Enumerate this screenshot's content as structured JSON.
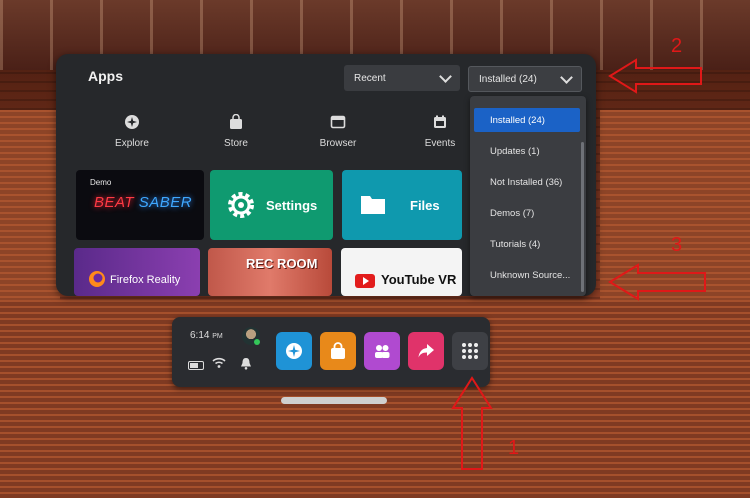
{
  "panel": {
    "title": "Apps",
    "sort_dropdown": {
      "value": "Recent"
    },
    "filter_dropdown": {
      "value": "Installed (24)"
    },
    "nav": [
      {
        "label": "Explore",
        "icon": "explore-icon"
      },
      {
        "label": "Store",
        "icon": "store-icon"
      },
      {
        "label": "Browser",
        "icon": "browser-icon"
      },
      {
        "label": "Events",
        "icon": "events-icon"
      }
    ],
    "tiles": {
      "beat_saber": {
        "badge": "Demo",
        "logo_a": "BEAT ",
        "logo_b": "SABER"
      },
      "settings": {
        "label": "Settings"
      },
      "files": {
        "label": "Files"
      },
      "firefox": {
        "label": "Firefox Reality"
      },
      "rec_room": {
        "label": "REC ROOM"
      },
      "youtube": {
        "label": "YouTube VR"
      }
    }
  },
  "filter_menu": {
    "items": [
      {
        "label": "Installed (24)",
        "selected": true
      },
      {
        "label": "Updates (1)",
        "selected": false
      },
      {
        "label": "Not Installed (36)",
        "selected": false
      },
      {
        "label": "Demos (7)",
        "selected": false
      },
      {
        "label": "Tutorials (4)",
        "selected": false
      },
      {
        "label": "Unknown Source...",
        "selected": false
      }
    ]
  },
  "taskbar": {
    "time": "6:14",
    "ampm": "PM",
    "buttons": [
      "explore-icon",
      "store-icon",
      "people-icon",
      "share-icon",
      "apps-grid-icon"
    ]
  },
  "annotations": {
    "one": "1",
    "two": "2",
    "three": "3",
    "color": "#e01818"
  },
  "colors": {
    "selected": "#1b62c6",
    "settings": "#0f9a70",
    "files": "#0f99ae"
  }
}
